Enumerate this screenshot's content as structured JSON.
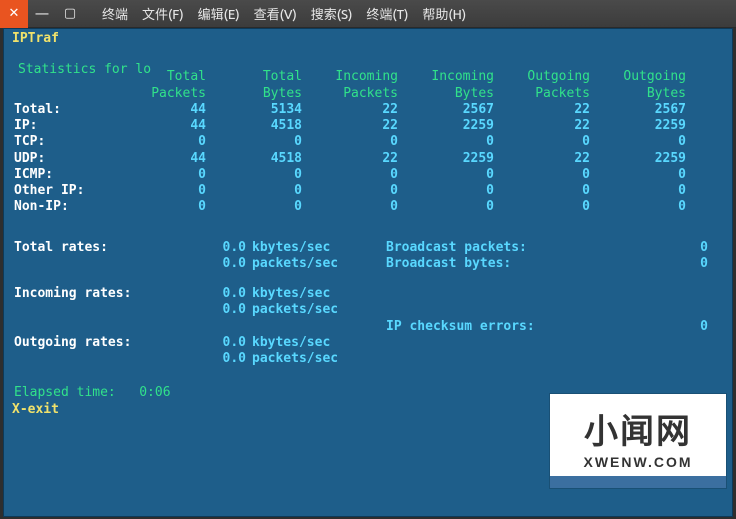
{
  "titlebar": {
    "menu": [
      "终端",
      "文件(F)",
      "编辑(E)",
      "查看(V)",
      "搜索(S)",
      "终端(T)",
      "帮助(H)"
    ]
  },
  "app": {
    "title": "IPTraf"
  },
  "box": {
    "label": "Statistics for lo"
  },
  "headers": {
    "col1a": "Total",
    "col1b": "Packets",
    "col2a": "Total",
    "col2b": "Bytes",
    "col3a": "Incoming",
    "col3b": "Packets",
    "col4a": "Incoming",
    "col4b": "Bytes",
    "col5a": "Outgoing",
    "col5b": "Packets",
    "col6a": "Outgoing",
    "col6b": "Bytes"
  },
  "rows": [
    {
      "label": "Total:",
      "v": [
        "44",
        "5134",
        "22",
        "2567",
        "22",
        "2567"
      ]
    },
    {
      "label": "IP:",
      "v": [
        "44",
        "4518",
        "22",
        "2259",
        "22",
        "2259"
      ]
    },
    {
      "label": "TCP:",
      "v": [
        "0",
        "0",
        "0",
        "0",
        "0",
        "0"
      ]
    },
    {
      "label": "UDP:",
      "v": [
        "44",
        "4518",
        "22",
        "2259",
        "22",
        "2259"
      ]
    },
    {
      "label": "ICMP:",
      "v": [
        "0",
        "0",
        "0",
        "0",
        "0",
        "0"
      ]
    },
    {
      "label": "Other IP:",
      "v": [
        "0",
        "0",
        "0",
        "0",
        "0",
        "0"
      ]
    },
    {
      "label": "Non-IP:",
      "v": [
        "0",
        "0",
        "0",
        "0",
        "0",
        "0"
      ]
    }
  ],
  "rates": {
    "total_label": "Total rates:",
    "incoming_label": "Incoming rates:",
    "outgoing_label": "Outgoing rates:",
    "kbytes_val": "0.0",
    "kbytes_unit": "kbytes/sec",
    "packets_val": "0.0",
    "packets_unit": "packets/sec"
  },
  "bcast": {
    "packets_label": "Broadcast packets:",
    "packets_val": "0",
    "bytes_label": "Broadcast bytes:",
    "bytes_val": "0"
  },
  "cksum": {
    "label": "IP checksum errors:",
    "val": "0"
  },
  "elapsed": {
    "label": "Elapsed time:",
    "value": "0:06"
  },
  "footer": {
    "exit": "X-exit"
  },
  "watermark": {
    "big": "小闻网",
    "small": "XWENW.COM"
  }
}
